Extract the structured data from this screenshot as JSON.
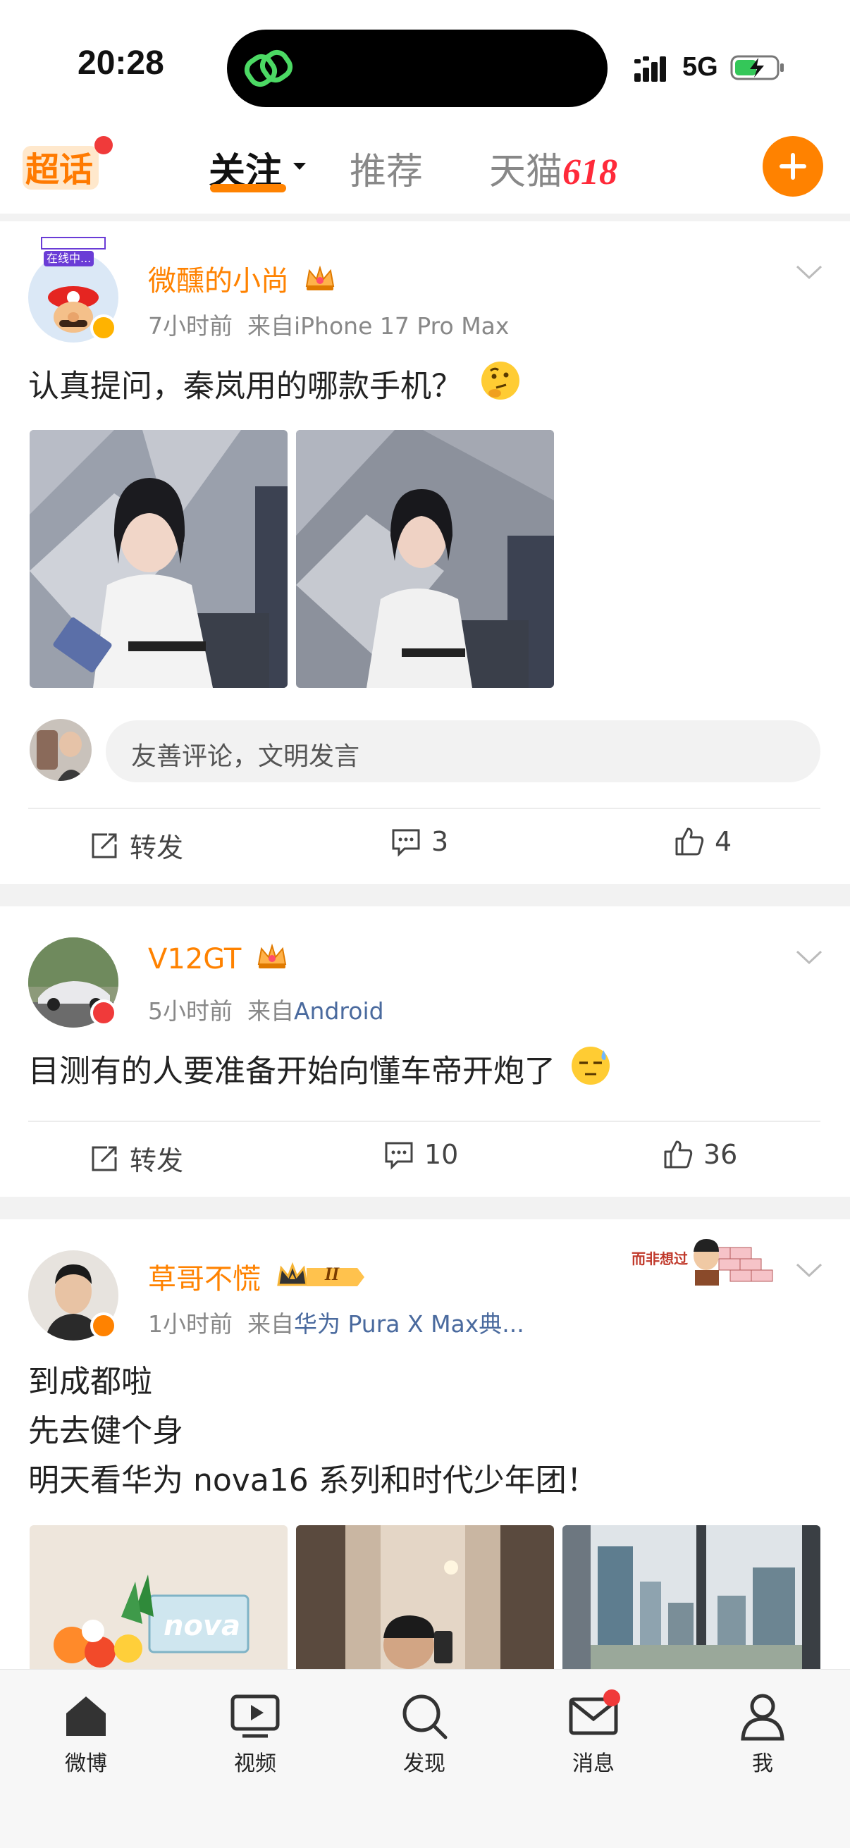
{
  "status_bar": {
    "time": "20:28",
    "network": "5G"
  },
  "top_nav": {
    "badge_label": "超话",
    "tabs": [
      {
        "label": "关注"
      },
      {
        "label": "推荐"
      },
      {
        "label": "天猫",
        "suffix": "618"
      }
    ],
    "active_tab": "关注"
  },
  "posts": [
    {
      "username": "微醺的小尚",
      "avatar_tag": "在线中...",
      "time": "7小时前",
      "source_prefix": "来自",
      "source": "iPhone 17 Pro Max",
      "text": "认真提问，秦岚用的哪款手机？",
      "comment_placeholder": "友善评论，文明发言",
      "repost_label": "转发",
      "comments": "3",
      "likes": "4"
    },
    {
      "username": "V12GT",
      "time": "5小时前",
      "source_prefix": "来自",
      "source": "Android",
      "text": "目测有的人要准备开始向懂车帝开炮了",
      "repost_label": "转发",
      "comments": "10",
      "likes": "36"
    },
    {
      "username": "草哥不慌",
      "level_badge": "II",
      "sticker_text": "而非想过",
      "time": "1小时前",
      "source_prefix": "来自",
      "source": "华为 Pura X Max典...",
      "text_lines": [
        "到成都啦",
        "先去健个身",
        "明天看华为 nova16 系列和时代少年团！"
      ],
      "photo_text": "nova"
    }
  ],
  "bottom_tabs": [
    {
      "label": "微博",
      "icon": "home-icon"
    },
    {
      "label": "视频",
      "icon": "video-icon"
    },
    {
      "label": "发现",
      "icon": "search-icon"
    },
    {
      "label": "消息",
      "icon": "mail-icon"
    },
    {
      "label": "我",
      "icon": "person-icon"
    }
  ],
  "colors": {
    "accent": "#ff8200",
    "link": "#4a6a9e",
    "badge_red": "#f03a3a"
  }
}
